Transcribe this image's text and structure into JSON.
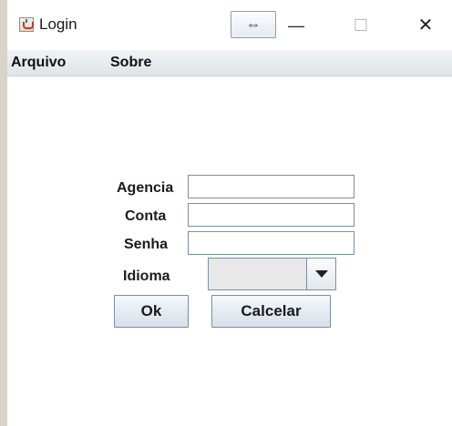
{
  "window": {
    "title": "Login",
    "resize_glyph": "⇔",
    "minimize_glyph": "—",
    "maximize_glyph": "☐",
    "close_glyph": "✕"
  },
  "menu": {
    "items": [
      {
        "label": "Arquivo"
      },
      {
        "label": "Sobre"
      }
    ]
  },
  "form": {
    "agencia": {
      "label": "Agencia",
      "value": ""
    },
    "conta": {
      "label": "Conta",
      "value": ""
    },
    "senha": {
      "label": "Senha",
      "value": ""
    },
    "idioma": {
      "label": "Idioma",
      "selected": ""
    },
    "ok_label": "Ok",
    "cancel_label": "Calcelar"
  }
}
